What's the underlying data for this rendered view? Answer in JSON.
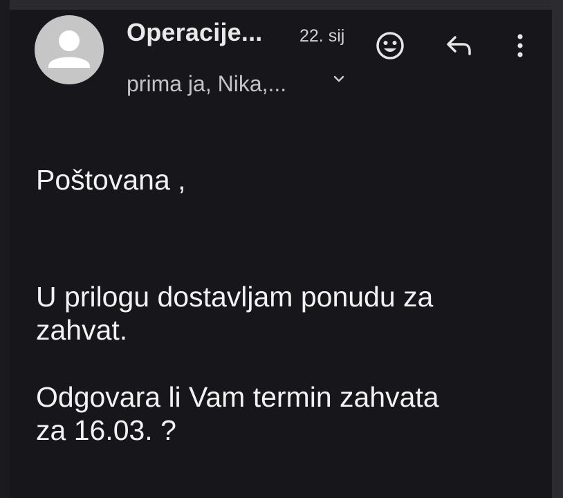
{
  "email": {
    "sender": "Operacije...",
    "date": "22. sij",
    "recipients": "prima ja, Nika,..."
  },
  "body": {
    "greeting": "Poštovana ,",
    "paragraph1": [
      "U prilogu dostavljam ponudu za",
      "zahvat."
    ],
    "paragraph2": [
      "Odgovara li Vam termin zahvata",
      "za 16.03. ?"
    ]
  },
  "icons": {
    "avatar": "person-icon",
    "emoji": "emoji-reaction-icon",
    "reply": "reply-icon",
    "more": "more-vertical-icon",
    "expand": "chevron-down-icon"
  },
  "colors": {
    "background": "#16161b",
    "avatar": "#c6c6c6",
    "text": "#f2f2f2",
    "secondary_text": "#c4c4c4"
  }
}
